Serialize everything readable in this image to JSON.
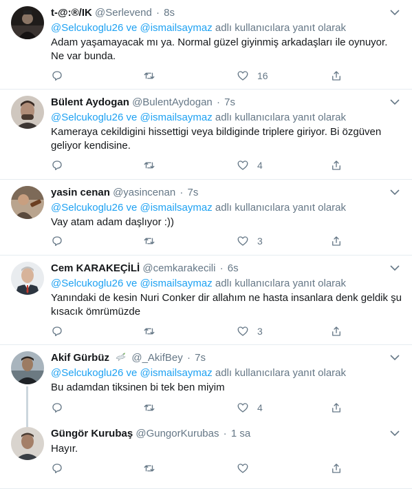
{
  "tweets": [
    {
      "name": "t-@:®/IK",
      "handle": "@Serlevend",
      "time": "8s",
      "reply_prefix": "@Selcukoglu26",
      "reply_and": "ve",
      "reply_mention2": "@ismailsaymaz",
      "reply_suffix": "adlı kullanıcılara yanıt olarak",
      "text": "Adam yaşamayacak mı ya. Normal güzel giyinmiş arkadaşları ile oynuyor. Ne var bunda.",
      "likes": "16"
    },
    {
      "name": "Bülent Aydogan",
      "handle": "@BulentAydogan",
      "time": "7s",
      "reply_prefix": "@Selcukoglu26",
      "reply_and": "ve",
      "reply_mention2": "@ismailsaymaz",
      "reply_suffix": "adlı kullanıcılara yanıt olarak",
      "text": "Kameraya cekildigini hissettigi veya bildiginde triplere giriyor. Bi özgüven geliyor kendisine.",
      "likes": "4"
    },
    {
      "name": "yasin cenan",
      "handle": "@yasincenan",
      "time": "7s",
      "reply_prefix": "@Selcukoglu26",
      "reply_and": "ve",
      "reply_mention2": "@ismailsaymaz",
      "reply_suffix": "adlı kullanıcılara yanıt olarak",
      "text": "Vay atam adam daşlıyor :))",
      "likes": "3"
    },
    {
      "name": "Cem KARAKEÇİLİ",
      "handle": "@cemkarakecili",
      "time": "6s",
      "reply_prefix": "@Selcukoglu26",
      "reply_and": "ve",
      "reply_mention2": "@ismailsaymaz",
      "reply_suffix": "adlı kullanıcılara yanıt olarak",
      "text": "Yanındaki de kesin Nuri Conker dir allahım ne hasta insanlara denk geldik şu kısacık ömrümüzde",
      "likes": "3"
    },
    {
      "name": "Akif Gürbüz",
      "name_emoji": "dove-emoji",
      "handle": "@_AkifBey",
      "time": "7s",
      "reply_prefix": "@Selcukoglu26",
      "reply_and": "ve",
      "reply_mention2": "@ismailsaymaz",
      "reply_suffix": "adlı kullanıcılara yanıt olarak",
      "text": "Bu adamdan tiksinen bi tek ben miyim",
      "likes": "4"
    },
    {
      "name": "Güngör Kurubaş",
      "handle": "@GungorKurubas",
      "time": "1 sa",
      "text": "Hayır.",
      "likes": ""
    }
  ],
  "time_separator": "·",
  "colors": {
    "link": "#1da1f2",
    "muted": "#657786",
    "text": "#14171a",
    "border": "#e6ecf0",
    "thread": "#ccd6dd"
  },
  "icons": [
    "reply-icon",
    "retweet-icon",
    "like-icon",
    "share-icon",
    "chevron-down-icon",
    "dove-emoji"
  ]
}
